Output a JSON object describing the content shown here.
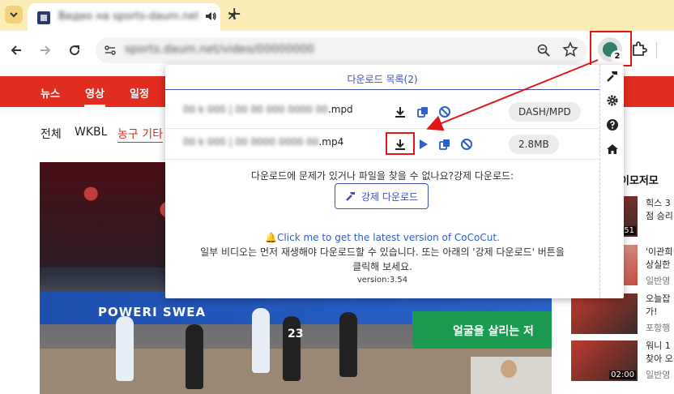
{
  "browser": {
    "tab": {
      "title": "Видео на sports-daum.net",
      "close": "✕"
    },
    "new_tab": "+",
    "url": "sports.daum.net/video/00000000",
    "extension_badge": "2"
  },
  "site": {
    "nav": [
      "뉴스",
      "영상",
      "일정"
    ],
    "subtabs": [
      "전체",
      "WKBL",
      "농구 기타"
    ],
    "video": {
      "board_text": "POWERI SWEA",
      "green_board_text": "얼굴을 살리는 저",
      "jersey_number": "23"
    },
    "sidebar": {
      "title": "이모저모",
      "items": [
        {
          "line1": "힉스 3",
          "line2": "점 승리",
          "meta": "",
          "duration": "51"
        },
        {
          "line1": "'이관희",
          "line2": "상실한",
          "meta": "일반영",
          "duration": ""
        },
        {
          "line1": "오늘잡",
          "line2": "가!",
          "meta": "포항행",
          "duration": ""
        },
        {
          "line1": "워니 1",
          "line2": "찾아 오",
          "meta": "일반영",
          "duration": "02:00"
        }
      ]
    }
  },
  "popup": {
    "title": "다운로드 목록(2)",
    "files": [
      {
        "name_hidden": "00 k 000 | 00 00 000 0000 00",
        "ext": ".mpd",
        "type": "DASH/MPD"
      },
      {
        "name_hidden": "00 k 000 | 00 0000 0000 00",
        "ext": ".mp4",
        "type": "2.8MB"
      }
    ],
    "help": "다운로드에 문제가 있거나 파일을 찾을 수 없나요?강제 다운로드:",
    "force_button": "강제 다운로드",
    "latest_link": "🔔Click me to get the latest version of CoCoCut.",
    "note": "일부 비디오는 먼저 재생해야 다운로드할 수 있습니다. 또는 아래의 '강제 다운로드' 버튼을 클릭해 보세요.",
    "version": "version:3.54"
  },
  "colors": {
    "accent": "#3f51b5",
    "site_red": "#e22c1f",
    "annotation_red": "#e3141a",
    "tab_strip": "#fbecb8"
  }
}
